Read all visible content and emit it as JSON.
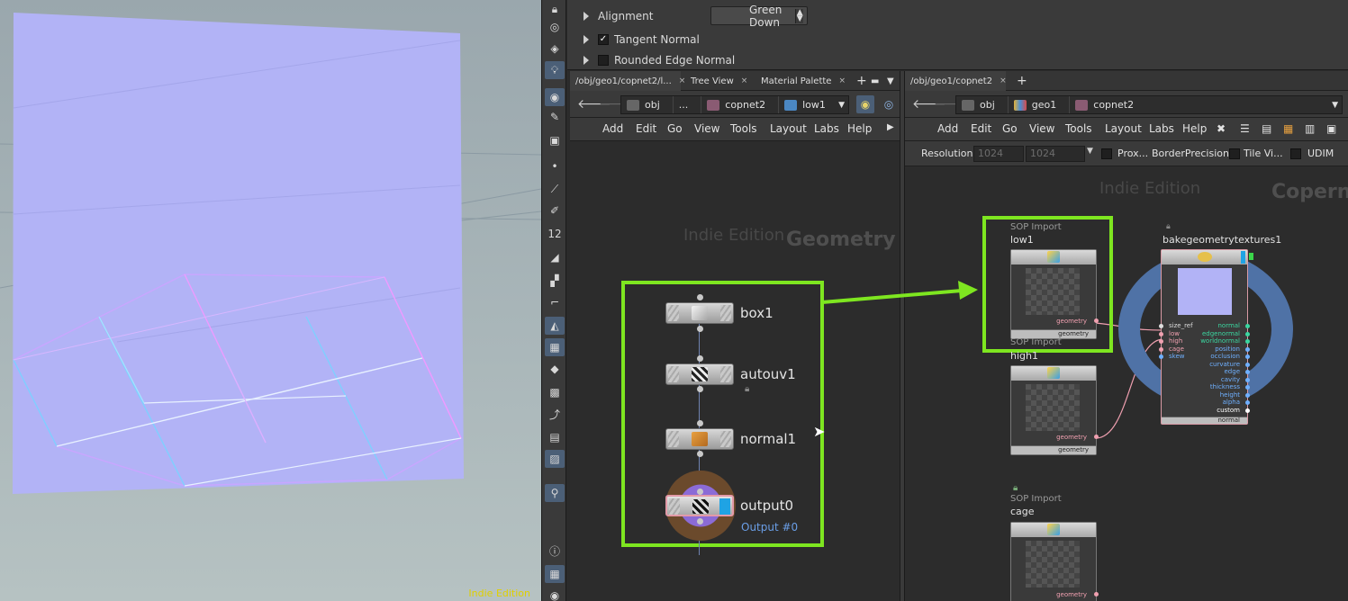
{
  "viewport": {
    "watermark": "Indie Edition"
  },
  "params": {
    "alignment_label": "Alignment",
    "alignment_value": "Green Down",
    "tangent_normal_label": "Tangent Normal",
    "rounded_edge_label": "Rounded Edge Normal"
  },
  "left_pane": {
    "tabs": [
      "/obj/geo1/copnet2/l...",
      "Tree View",
      "Material Palette"
    ],
    "path": [
      "obj",
      "...",
      "copnet2",
      "low1"
    ],
    "menus": [
      "Add",
      "Edit",
      "Go",
      "View",
      "Tools",
      "Layout",
      "Labs",
      "Help"
    ],
    "watermark_edition": "Indie Edition",
    "watermark_context": "Geometry",
    "nodes": [
      {
        "name": "box1"
      },
      {
        "name": "autouv1"
      },
      {
        "name": "normal1"
      },
      {
        "name": "output0",
        "sublabel": "Output #0"
      }
    ]
  },
  "right_pane": {
    "tabs": [
      "/obj/geo1/copnet2"
    ],
    "path": [
      "obj",
      "geo1",
      "copnet2"
    ],
    "menus": [
      "Add",
      "Edit",
      "Go",
      "View",
      "Tools",
      "Layout",
      "Labs",
      "Help"
    ],
    "resolution_label": "Resolution",
    "res_x": "1024",
    "res_y": "1024",
    "prox_label": "Prox...",
    "border_label": "BorderPrecision",
    "tile_label": "Tile Vi...",
    "udim_label": "UDIM",
    "watermark_edition": "Indie Edition",
    "watermark_context": "Copern",
    "cop_nodes": [
      {
        "type": "SOP Import",
        "name": "low1",
        "port": "geometry",
        "footer": "geometry"
      },
      {
        "type": "SOP Import",
        "name": "high1",
        "port": "geometry",
        "footer": "geometry"
      },
      {
        "type": "SOP Import",
        "name": "cage",
        "port": "geometry"
      }
    ],
    "bake_node": {
      "name": "bakegeometrytextures1",
      "inputs": [
        "size_ref",
        "low",
        "high",
        "cage",
        "skew"
      ],
      "outputs": [
        "normal",
        "edgenormal",
        "worldnormal",
        "position",
        "occlusion",
        "curvature",
        "edge",
        "cavity",
        "thickness",
        "height",
        "alpha",
        "custom"
      ],
      "footer": "normal"
    }
  },
  "colors": {
    "highlight": "#7ee620",
    "accent": "#4b6fa6"
  }
}
